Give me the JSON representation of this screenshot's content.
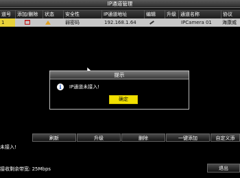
{
  "window": {
    "title": "IP通道管理"
  },
  "table": {
    "headers": [
      "道号",
      "添加/删除",
      "状态",
      "安全性",
      "IP通道地址",
      "编辑",
      "升级",
      "通道名称",
      "协议"
    ],
    "rows": [
      {
        "channel": "1",
        "security": "弱密码",
        "ip": "192.168.1.64",
        "name": "IPCamera 01",
        "protocol": "海康威"
      }
    ]
  },
  "dialog": {
    "title": "提示",
    "message": "IP通道未接入!",
    "ok_label": "确定",
    "icon": "info-icon"
  },
  "buttons": [
    "刷新",
    "升级",
    "删除",
    "一键添加",
    "自定义添"
  ],
  "status": {
    "message": "未接入!",
    "bandwidth": "接收剩余带宽: 25Mbps"
  },
  "exit_label": "退出",
  "colors": {
    "selection": "#e8d23a",
    "ok_button": "#f2e000",
    "row": "#c7c7c7"
  }
}
